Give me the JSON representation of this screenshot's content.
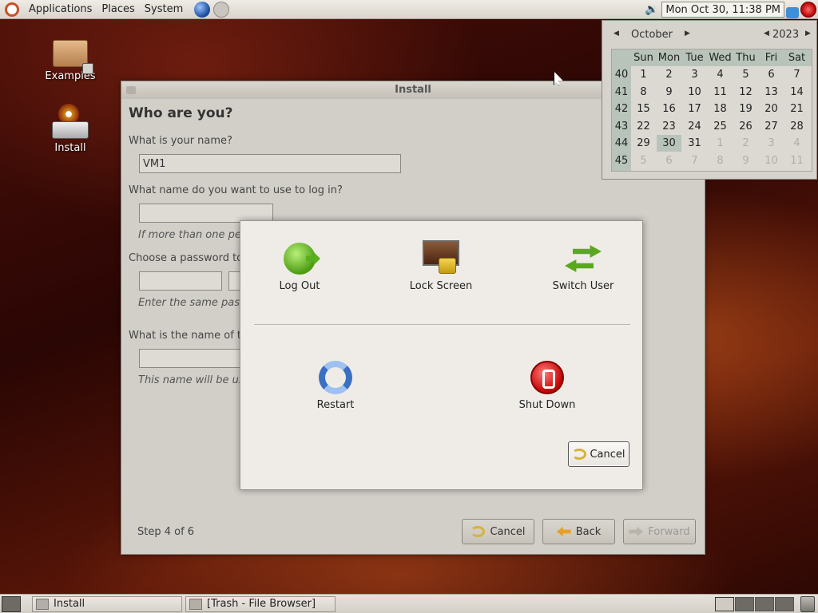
{
  "top_panel": {
    "menus": [
      "Applications",
      "Places",
      "System"
    ],
    "clock": "Mon Oct 30, 11:38 PM"
  },
  "desktop": {
    "icons": [
      {
        "label": "Examples",
        "icon": "folder-icon"
      },
      {
        "label": "Install",
        "icon": "installer-icon"
      }
    ]
  },
  "install_window": {
    "title": "Install",
    "heading": "Who are you?",
    "name_question": "What is your name?",
    "name_value": "VM1",
    "login_question": "What name do you want to use to log in?",
    "login_value": "",
    "login_hint": "If more than one pe",
    "password_question": "Choose a password to",
    "password_hint": "Enter the same pass",
    "computer_question": "What is the name of th",
    "computer_hint": "This name will be us",
    "step": "Step 4 of 6",
    "buttons": {
      "cancel": "Cancel",
      "back": "Back",
      "forward": "Forward"
    }
  },
  "calendar": {
    "month": "October",
    "year": "2023",
    "days_of_week": [
      "Sun",
      "Mon",
      "Tue",
      "Wed",
      "Thu",
      "Fri",
      "Sat"
    ],
    "weeks": [
      {
        "week": "40",
        "days": [
          "",
          "1",
          "2",
          "3",
          "4",
          "5",
          "6",
          "7"
        ]
      },
      {
        "week": "41",
        "days": [
          "",
          "8",
          "9",
          "10",
          "11",
          "12",
          "13",
          "14"
        ]
      },
      {
        "week": "42",
        "days": [
          "",
          "15",
          "16",
          "17",
          "18",
          "19",
          "20",
          "21"
        ]
      },
      {
        "week": "43",
        "days": [
          "",
          "22",
          "23",
          "24",
          "25",
          "26",
          "27",
          "28"
        ]
      },
      {
        "week": "44",
        "days": [
          "",
          "29",
          "30",
          "31",
          "1",
          "2",
          "3",
          "4"
        ]
      },
      {
        "week": "45",
        "days": [
          "",
          "5",
          "6",
          "7",
          "8",
          "9",
          "10",
          "11"
        ]
      }
    ],
    "selected_day": "30"
  },
  "logout_dialog": {
    "actions": {
      "log_out": "Log Out",
      "lock_screen": "Lock Screen",
      "switch_user": "Switch User",
      "restart": "Restart",
      "shut_down": "Shut Down"
    },
    "cancel": "Cancel"
  },
  "taskbar": {
    "tasks": [
      "Install",
      "[Trash - File Browser]"
    ]
  }
}
